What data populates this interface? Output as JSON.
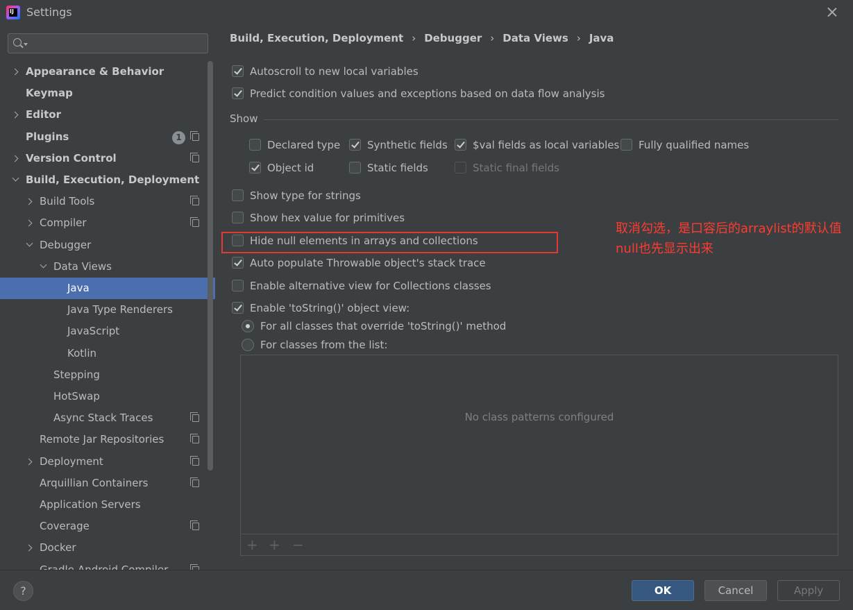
{
  "window": {
    "title": "Settings"
  },
  "search": {
    "placeholder": ""
  },
  "sidebar": {
    "items": [
      {
        "label": "Appearance & Behavior",
        "bold": true,
        "expander": "right",
        "icon": false
      },
      {
        "label": "Keymap",
        "bold": true,
        "expander": "",
        "icon": false
      },
      {
        "label": "Editor",
        "bold": true,
        "expander": "right",
        "icon": false
      },
      {
        "label": "Plugins",
        "bold": true,
        "expander": "",
        "icon": true,
        "badge": "1"
      },
      {
        "label": "Version Control",
        "bold": true,
        "expander": "right",
        "icon": true
      },
      {
        "label": "Build, Execution, Deployment",
        "bold": true,
        "expander": "down",
        "icon": false
      },
      {
        "label": "Build Tools",
        "bold": false,
        "expander": "right",
        "icon": true
      },
      {
        "label": "Compiler",
        "bold": false,
        "expander": "right",
        "icon": true
      },
      {
        "label": "Debugger",
        "bold": false,
        "expander": "down",
        "icon": false
      },
      {
        "label": "Data Views",
        "bold": false,
        "expander": "down",
        "icon": false
      },
      {
        "label": "Java",
        "bold": false,
        "expander": "",
        "icon": false,
        "selected": true
      },
      {
        "label": "Java Type Renderers",
        "bold": false,
        "expander": "",
        "icon": false
      },
      {
        "label": "JavaScript",
        "bold": false,
        "expander": "",
        "icon": false
      },
      {
        "label": "Kotlin",
        "bold": false,
        "expander": "",
        "icon": false
      },
      {
        "label": "Stepping",
        "bold": false,
        "expander": "",
        "icon": false
      },
      {
        "label": "HotSwap",
        "bold": false,
        "expander": "",
        "icon": false
      },
      {
        "label": "Async Stack Traces",
        "bold": false,
        "expander": "",
        "icon": true
      },
      {
        "label": "Remote Jar Repositories",
        "bold": false,
        "expander": "",
        "icon": true
      },
      {
        "label": "Deployment",
        "bold": false,
        "expander": "right",
        "icon": true
      },
      {
        "label": "Arquillian Containers",
        "bold": false,
        "expander": "",
        "icon": true
      },
      {
        "label": "Application Servers",
        "bold": false,
        "expander": "",
        "icon": false
      },
      {
        "label": "Coverage",
        "bold": false,
        "expander": "",
        "icon": true
      },
      {
        "label": "Docker",
        "bold": false,
        "expander": "right",
        "icon": false
      },
      {
        "label": "Gradle-Android Compiler",
        "bold": false,
        "expander": "",
        "icon": true
      }
    ]
  },
  "breadcrumb": [
    "Build, Execution, Deployment",
    "Debugger",
    "Data Views",
    "Java"
  ],
  "breadcrumb_sep": "›",
  "options": {
    "autoscroll": {
      "label": "Autoscroll to new local variables",
      "checked": true
    },
    "predict": {
      "label": "Predict condition values and exceptions based on data flow analysis",
      "checked": true
    },
    "show_title": "Show",
    "declared_type": {
      "label": "Declared type",
      "checked": false
    },
    "synthetic_fields": {
      "label": "Synthetic fields",
      "checked": true
    },
    "val_fields": {
      "label": "$val fields as local variables",
      "checked": true
    },
    "fully_qualified": {
      "label": "Fully qualified names",
      "checked": false
    },
    "object_id": {
      "label": "Object id",
      "checked": true
    },
    "static_fields": {
      "label": "Static fields",
      "checked": false
    },
    "static_final_fields": {
      "label": "Static final fields",
      "checked": false,
      "disabled": true
    },
    "type_for_strings": {
      "label": "Show type for strings",
      "checked": false
    },
    "hex_primitives": {
      "label": "Show hex value for primitives",
      "checked": false
    },
    "hide_null": {
      "label": "Hide null elements in arrays and collections",
      "checked": false
    },
    "auto_populate": {
      "label": "Auto populate Throwable object's stack trace",
      "checked": true
    },
    "alt_view": {
      "label": "Enable alternative view for Collections classes",
      "checked": false
    },
    "tostring_view": {
      "label": "Enable 'toString()' object view:",
      "checked": true
    },
    "radio_all": {
      "label": "For all classes that override 'toString()' method",
      "checked": true
    },
    "radio_list": {
      "label": "For classes from the list:",
      "checked": false
    }
  },
  "pattern_list": {
    "empty_text": "No class patterns configured"
  },
  "annotation": {
    "text": "取消勾选，是口容后的arraylist的默认值null也先显示出来",
    "color": "#ff3b30"
  },
  "buttons": {
    "ok": "OK",
    "cancel": "Cancel",
    "apply": "Apply",
    "help": "?"
  },
  "colors": {
    "selection": "#4b6eaf",
    "accent_ok": "#365880",
    "highlight": "#e53935"
  }
}
